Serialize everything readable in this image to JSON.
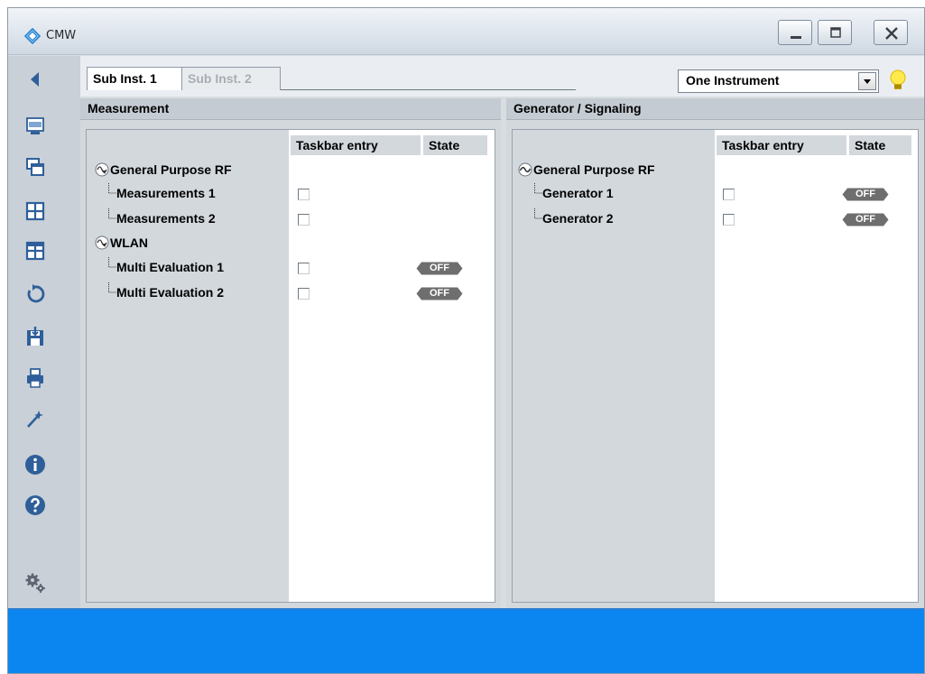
{
  "window": {
    "title": "CMW",
    "accent": "#0b86f0"
  },
  "tabs": [
    {
      "label": "Sub Inst. 1",
      "active": true
    },
    {
      "label": "Sub Inst. 2",
      "active": false
    }
  ],
  "instrument_select": {
    "value": "One Instrument"
  },
  "sidebar_icons": [
    "back-arrow-icon",
    "cmw-screen-icon",
    "windows-icon",
    "grid-icon",
    "grid-icon",
    "refresh-icon",
    "save-icon",
    "print-icon",
    "wizard-icon",
    "info-icon",
    "help-icon",
    "settings-icon"
  ],
  "measurement_panel": {
    "title": "Measurement",
    "col_taskbar": "Taskbar entry",
    "col_state": "State",
    "groups": [
      {
        "name": "General Purpose RF",
        "items": [
          {
            "label": "Measurements 1",
            "taskbar": false,
            "state": ""
          },
          {
            "label": "Measurements 2",
            "taskbar": false,
            "state": ""
          }
        ]
      },
      {
        "name": "WLAN",
        "items": [
          {
            "label": "Multi Evaluation 1",
            "taskbar": false,
            "state": "OFF"
          },
          {
            "label": "Multi Evaluation 2",
            "taskbar": false,
            "state": "OFF"
          }
        ]
      }
    ]
  },
  "generator_panel": {
    "title": "Generator / Signaling",
    "col_taskbar": "Taskbar entry",
    "col_state": "State",
    "groups": [
      {
        "name": "General Purpose RF",
        "items": [
          {
            "label": "Generator 1",
            "taskbar": false,
            "state": "OFF"
          },
          {
            "label": "Generator 2",
            "taskbar": false,
            "state": "OFF"
          }
        ]
      }
    ]
  }
}
